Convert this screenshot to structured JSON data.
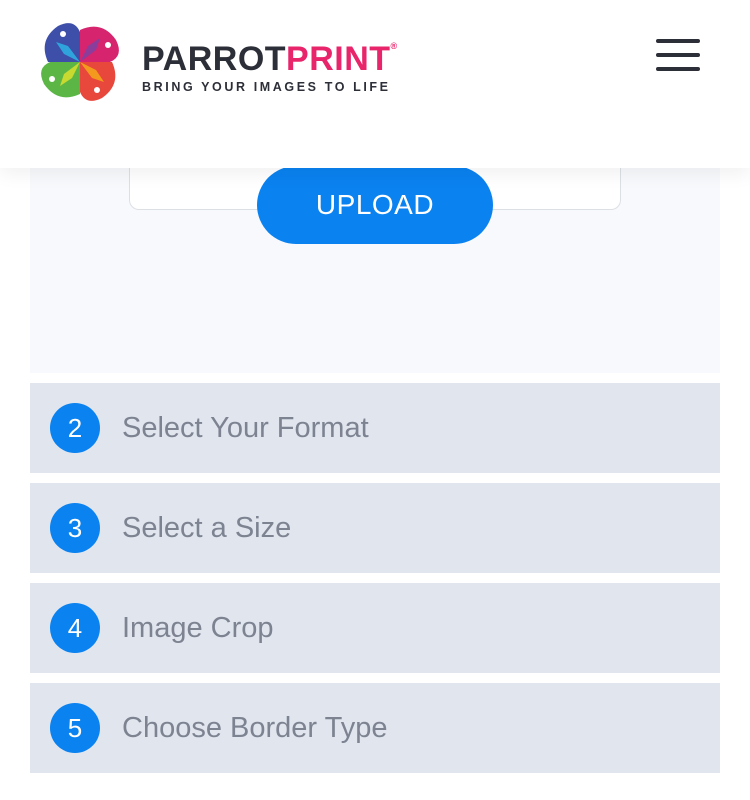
{
  "header": {
    "brand_part1": "PARROT",
    "brand_part2": "PRINT",
    "brand_mark": "®",
    "tagline": "BRING YOUR IMAGES TO LIFE",
    "logo_icon": "parrot-pinwheel-logo",
    "menu_icon": "hamburger-menu-icon"
  },
  "upload": {
    "button_label": "UPLOAD"
  },
  "steps": [
    {
      "number": "2",
      "label": "Select Your Format"
    },
    {
      "number": "3",
      "label": "Select a Size"
    },
    {
      "number": "4",
      "label": "Image Crop"
    },
    {
      "number": "5",
      "label": "Choose Border Type"
    }
  ],
  "colors": {
    "accent_blue": "#0a82f0",
    "brand_pink": "#e8246a",
    "brand_dark": "#2d2f38",
    "step_bg": "#e0e5ee",
    "step_text": "#7d8391"
  }
}
